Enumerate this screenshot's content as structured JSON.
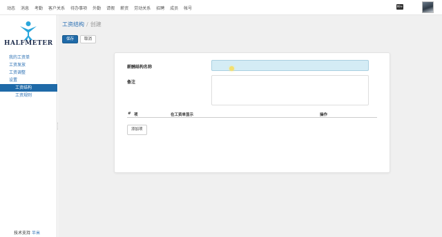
{
  "topnav": {
    "items": [
      "动态",
      "消息",
      "考勤",
      "客户关系",
      "待办事项",
      "外勤",
      "请假",
      "薪资",
      "劳动关系",
      "招聘",
      "成员",
      "帐号"
    ],
    "badge_text": "99+"
  },
  "sidebar": {
    "logo_text": "HALFMETER",
    "items": [
      {
        "label": "我的工资单"
      },
      {
        "label": "工资发放"
      },
      {
        "label": "工资调整"
      },
      {
        "label": "设置"
      },
      {
        "label": "工资结构"
      },
      {
        "label": "工资规则"
      }
    ],
    "support_label": "技术支持",
    "support_link": "半米"
  },
  "breadcrumb": {
    "parent": "工资结构",
    "separator": "/",
    "current": "创建"
  },
  "actions": {
    "save_label": "保存",
    "cancel_label": "取消"
  },
  "form": {
    "name_label": "薪酬结构名称",
    "name_value": "",
    "remark_label": "备注",
    "remark_value": ""
  },
  "table": {
    "headers": [
      "#",
      "项",
      "在工资单显示",
      "操作"
    ]
  },
  "add_item_label": "添加项",
  "colors": {
    "primary": "#1f6aa8",
    "link": "#2a6fb3",
    "input_highlight": "#d4ecf5",
    "background": "#f0f0f0"
  }
}
